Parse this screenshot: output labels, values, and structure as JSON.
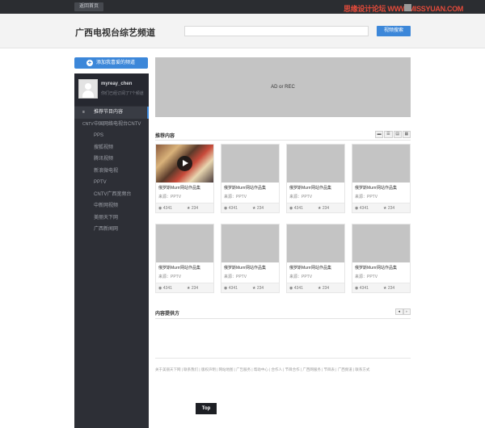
{
  "topbar": {
    "back_label": "返回首页"
  },
  "watermark": {
    "text": "思缘设计论坛 WWW.MISSYUAN.COM"
  },
  "header": {
    "title": "广西电视台综艺频道",
    "search_placeholder": "",
    "search_button": "视频搜索"
  },
  "sidebar": {
    "add_channel": "添加我喜爱的频道",
    "user": {
      "name": "myreay_chen",
      "status": "你们已经订阅了7个频道"
    },
    "items": [
      {
        "icon": "≡",
        "label": "推荐节目内容",
        "active": true
      },
      {
        "icon": "CNTV",
        "label": "中国网络电视台CNTV"
      },
      {
        "icon": "",
        "label": "PPS"
      },
      {
        "icon": "",
        "label": "搜狐视频"
      },
      {
        "icon": "",
        "label": "腾讯视频"
      },
      {
        "icon": "",
        "label": "新浪微电视"
      },
      {
        "icon": "",
        "label": "PPTV"
      },
      {
        "icon": "",
        "label": "CNTV广西宽频台"
      },
      {
        "icon": "",
        "label": "中新网视频"
      },
      {
        "icon": "",
        "label": "美丽天下网"
      },
      {
        "icon": "",
        "label": "广西新闻网"
      }
    ],
    "top_button": "Top"
  },
  "ad": {
    "text": "AD or REC"
  },
  "recommended": {
    "title": "推荐内容",
    "view_buttons": [
      "▬",
      "☰",
      "▤",
      "▦"
    ],
    "cards": [
      {
        "title": "俄罗斯Murrr网站作品集",
        "source": "来源：PPTV",
        "views": "4341",
        "stars": "234"
      },
      {
        "title": "俄罗斯Murrr网站作品集",
        "source": "来源：PPTV",
        "views": "4341",
        "stars": "234"
      },
      {
        "title": "俄罗斯Murrr网站作品集",
        "source": "来源：PPTV",
        "views": "4341",
        "stars": "234"
      },
      {
        "title": "俄罗斯Murrr网站作品集",
        "source": "来源：PPTV",
        "views": "4341",
        "stars": "234"
      },
      {
        "title": "俄罗斯Murrr网站作品集",
        "source": "来源：PPTV",
        "views": "4341",
        "stars": "234"
      },
      {
        "title": "俄罗斯Murrr网站作品集",
        "source": "来源：PPTV",
        "views": "4341",
        "stars": "234"
      },
      {
        "title": "俄罗斯Murrr网站作品集",
        "source": "来源：PPTV",
        "views": "4341",
        "stars": "234"
      },
      {
        "title": "俄罗斯Murrr网站作品集",
        "source": "来源：PPTV",
        "views": "4341",
        "stars": "234"
      }
    ]
  },
  "providers": {
    "title": "内容提供方",
    "prev": "◂",
    "next": "▸"
  },
  "footer": {
    "links": "关于美丽天下网 | 联系我们 | 版权声明 | 网站地图 | 广告服务 | 帮助中心 | 合作人 | 节目合作 | 广西网服务 | 节目表 | 广西频道 | 联系方式"
  }
}
